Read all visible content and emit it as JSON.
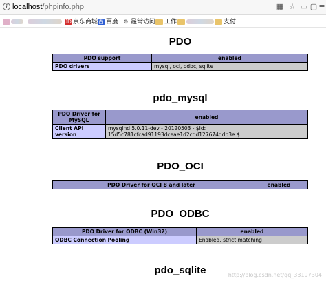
{
  "browser": {
    "url_host": "localhost",
    "url_path": "/phpinfo.php",
    "toolbar_icons": [
      "qr-icon",
      "star-icon",
      "minimize-icon",
      "square-icon",
      "menu-icon"
    ],
    "toolbar_glyphs": [
      "▦",
      "☆",
      "▭",
      "▢",
      "≡"
    ]
  },
  "bookmarks": {
    "jd": "京东商城",
    "baidu": "百度",
    "frequent": "最常访问",
    "work": "工作",
    "pay": "支付",
    "jd_glyph": "JD",
    "baidu_glyph": "百",
    "gear_glyph": "⚙"
  },
  "sections": {
    "pdo": {
      "title": "PDO",
      "rows": [
        [
          "PDO support",
          "enabled"
        ],
        [
          "PDO drivers",
          "mysql, oci, odbc, sqlite"
        ]
      ]
    },
    "pdo_mysql": {
      "title": "pdo_mysql",
      "rows": [
        [
          "PDO Driver for MySQL",
          "enabled"
        ],
        [
          "Client API version",
          "mysqlnd 5.0.11-dev - 20120503 - $Id: 15d5c781cfcad91193dceae1d2cdd127674ddb3e $"
        ]
      ]
    },
    "pdo_oci": {
      "title": "PDO_OCI",
      "rows": [
        [
          "PDO Driver for OCI 8 and later",
          "enabled"
        ]
      ]
    },
    "pdo_odbc": {
      "title": "PDO_ODBC",
      "rows": [
        [
          "PDO Driver for ODBC (Win32)",
          "enabled"
        ],
        [
          "ODBC Connection Pooling",
          "Enabled, strict matching"
        ]
      ]
    },
    "pdo_sqlite": {
      "title": "pdo_sqlite"
    }
  },
  "watermark": "http://blog.csdn.net/qq_33197304",
  "colors": {
    "header": "#9999cc",
    "label": "#ccccff",
    "value": "#cccccc"
  }
}
